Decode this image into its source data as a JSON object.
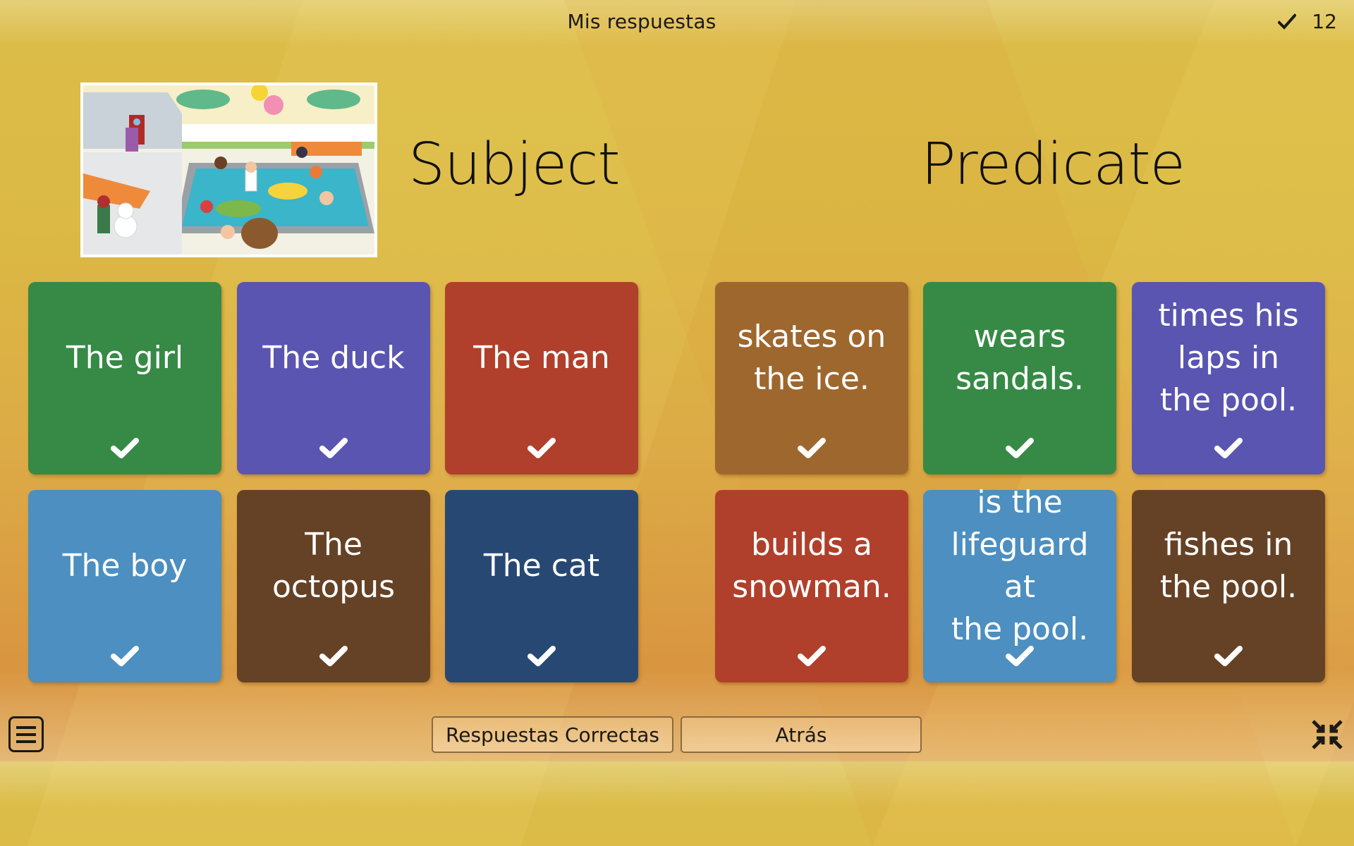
{
  "header": {
    "title": "Mis respuestas",
    "score_icon": "check-icon",
    "score": "12"
  },
  "activity": {
    "image_alt": "Cartoon pool party scene",
    "columns": [
      {
        "heading": "Subject"
      },
      {
        "heading": "Predicate"
      }
    ]
  },
  "cards": {
    "subject": [
      {
        "label": "The girl",
        "color": "#368a45",
        "status": "correct"
      },
      {
        "label": "The duck",
        "color": "#5a55b0",
        "status": "correct"
      },
      {
        "label": "The man",
        "color": "#b0402b",
        "status": "correct"
      },
      {
        "label": "The boy",
        "color": "#4c8fc0",
        "status": "correct"
      },
      {
        "label": "The\noctopus",
        "color": "#654226",
        "status": "correct"
      },
      {
        "label": "The cat",
        "color": "#284874",
        "status": "correct"
      }
    ],
    "predicate": [
      {
        "label": "skates on\nthe ice.",
        "color": "#9d672d",
        "status": "correct"
      },
      {
        "label": "wears\nsandals.",
        "color": "#368a45",
        "status": "correct"
      },
      {
        "label": "times his\nlaps in\nthe pool.",
        "color": "#5a55b0",
        "status": "correct"
      },
      {
        "label": "builds a\nsnowman.",
        "color": "#b0402b",
        "status": "correct"
      },
      {
        "label": "is the\nlifeguard at\nthe pool.",
        "color": "#4c8fc0",
        "status": "correct"
      },
      {
        "label": "fishes in\nthe pool.",
        "color": "#654226",
        "status": "correct"
      }
    ]
  },
  "footer": {
    "menu_icon": "menu-icon",
    "correct_answers_label": "Respuestas Correctas",
    "back_label": "Atrás",
    "fullscreen_icon": "exit-fullscreen-icon"
  }
}
